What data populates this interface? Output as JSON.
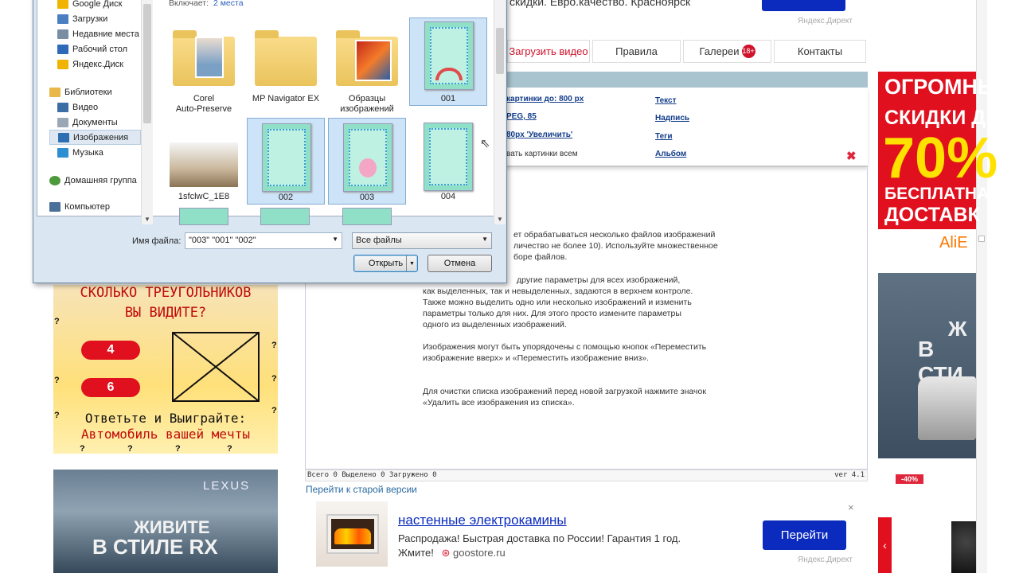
{
  "top_ad": {
    "text": "скидки. Евро.качество. Красноярск",
    "badge": "Яндекс.Директ"
  },
  "nav": {
    "items": [
      {
        "label": "Загрузить видео"
      },
      {
        "label": "Правила"
      },
      {
        "label": "Галереи",
        "badge": "18+"
      },
      {
        "label": "Контакты"
      }
    ]
  },
  "settings": {
    "left": [
      "картинки до: 800 px",
      "PEG, 85",
      "80px 'Увеличить'",
      "вать картинки всем"
    ],
    "right": [
      "Текст",
      "Надпись",
      "Теги",
      "Альбом"
    ],
    "remove": "✖"
  },
  "help": {
    "p1": [
      "ет обрабатываться несколько файлов изображений",
      "личество не более 10). Используйте множественное",
      "боре файлов."
    ],
    "p2": [
      "другие параметры для всех изображений,",
      "как выделенных, так и невыделенных, задаются в верхнем контроле.",
      "Также можно выделить одно или несколько изображений и изменить",
      "параметры только для них. Для этого просто измените параметры",
      "одного из выделенных изображений."
    ],
    "p3": [
      "Изображения могут быть упорядочены с помощью кнопок «Переместить",
      "изображение вверх» и «Переместить изображение вниз»."
    ],
    "p4": [
      "Для очистки списка изображений перед новой загрузкой нажмите значок",
      "«Удалить все изображения из списка»."
    ]
  },
  "status": {
    "text": "Всего 0  Выделено 0  Загружено 0",
    "version": "ver 4.1"
  },
  "old_version_link": "Перейти к старой версии",
  "bottom_ad": {
    "title": "настенные электрокамины",
    "desc": "Распродажа! Быстрая доставка по России! Гарантия 1 год.",
    "desc2": "Жмите!",
    "site": "goostore.ru",
    "button": "Перейти",
    "badge": "Яндекс.Директ",
    "close": "×"
  },
  "left_ad": {
    "title1": "СКОЛЬКО ТРЕУГОЛЬНИКОВ",
    "title2": "ВЫ ВИДИТЕ?",
    "opt1": "4",
    "opt2": "6",
    "bottom1": "Ответьте и Выиграйте:",
    "bottom2": "Автомобиль вашей мечты",
    "q": "?"
  },
  "lexus_ad": {
    "brand": "LEXUS",
    "line1": "ЖИВИТЕ",
    "line2": "В СТИЛЕ RX"
  },
  "right_ad": {
    "l1": "ОГРОМНЫ",
    "l2": "СКИДКИ Д",
    "l3": "70%",
    "l4": "БЕСПЛАТНА",
    "l5": "ДОСТАВК",
    "brand": "AliE",
    "car_text1": "Ж",
    "car_text2": "В СТИ",
    "disc": "-40%",
    "arrow": "‹"
  },
  "dialog": {
    "includes_label": "Включает:",
    "includes_value": "2 места",
    "sidebar": [
      {
        "label": "Google Диск",
        "color": "#f0b400"
      },
      {
        "label": "Загрузки",
        "color": "#4a7fc1"
      },
      {
        "label": "Недавние места",
        "color": "#7a8ea3"
      },
      {
        "label": "Рабочий стол",
        "color": "#2e6ab8"
      },
      {
        "label": "Яндекс.Диск",
        "color": "#f0b400"
      }
    ],
    "libraries": "Библиотеки",
    "lib_items": [
      {
        "label": "Видео",
        "color": "#3b6ea5"
      },
      {
        "label": "Документы",
        "color": "#9aa8b6"
      },
      {
        "label": "Изображения",
        "color": "#2d6fb1"
      },
      {
        "label": "Музыка",
        "color": "#2d8ed1"
      }
    ],
    "homegroup": "Домашняя группа",
    "computer": "Компьютер",
    "files": [
      {
        "label": "Corel",
        "label2": "Auto-Preserve",
        "kind": "folder-photo"
      },
      {
        "label": "MP Navigator EX",
        "label2": "",
        "kind": "folder"
      },
      {
        "label": "Образцы",
        "label2": "изображений",
        "kind": "folder-img"
      },
      {
        "label": "001",
        "label2": "",
        "kind": "doc"
      },
      {
        "label": "1sfclwC_1E8",
        "label2": "",
        "kind": "photo"
      },
      {
        "label": "002",
        "label2": "",
        "kind": "doc"
      },
      {
        "label": "003",
        "label2": "",
        "kind": "doc"
      },
      {
        "label": "004",
        "label2": "",
        "kind": "doc"
      }
    ],
    "filename_label": "Имя файла:",
    "filename_value": "\"003\" \"001\" \"002\"",
    "filter": "Все файлы",
    "open_btn": "Открыть",
    "cancel_btn": "Отмена"
  }
}
